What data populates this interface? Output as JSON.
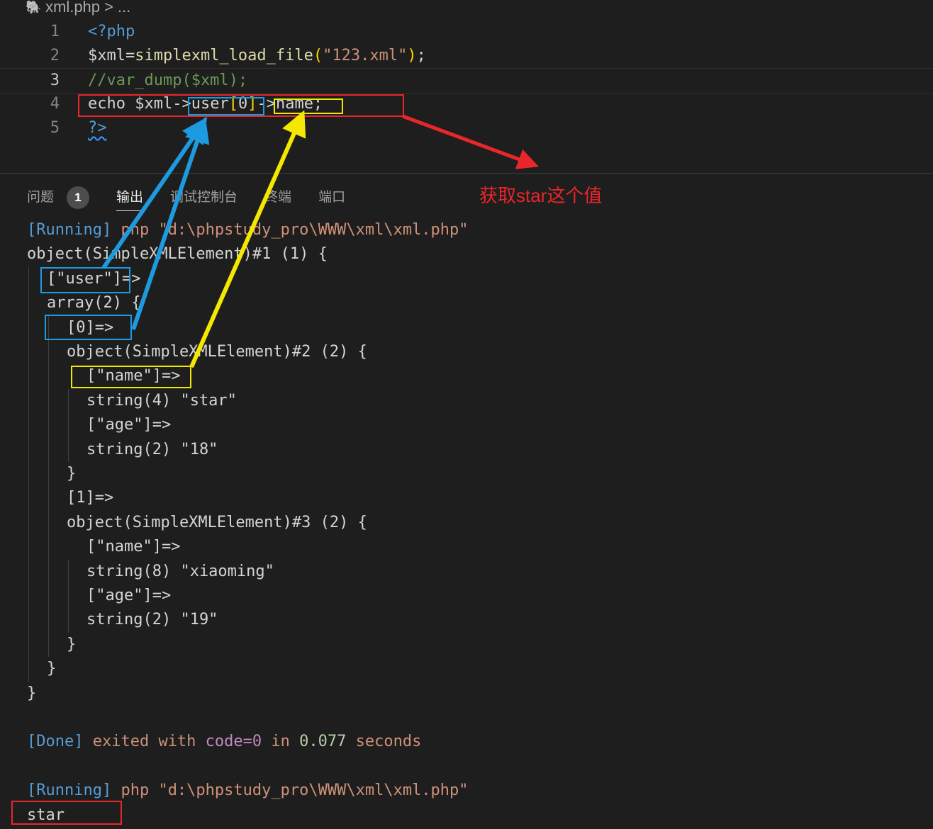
{
  "breadcrumb": {
    "file": "xml.php",
    "sep": ">",
    "more": "..."
  },
  "editor": {
    "lines": [
      {
        "n": "1",
        "parts": [
          {
            "t": "<?php",
            "c": "kw"
          }
        ]
      },
      {
        "n": "2",
        "parts": [
          {
            "t": "$xml",
            "c": "var"
          },
          {
            "t": "=",
            "c": "var"
          },
          {
            "t": "simplexml_load_file",
            "c": "fn"
          },
          {
            "t": "(",
            "c": "brk"
          },
          {
            "t": "\"123.xml\"",
            "c": "str"
          },
          {
            "t": ")",
            "c": "brk"
          },
          {
            "t": ";",
            "c": "var"
          }
        ]
      },
      {
        "n": "3",
        "parts": [
          {
            "t": "//var_dump($xml);",
            "c": "cmt"
          }
        ]
      },
      {
        "n": "4",
        "parts": [
          {
            "t": "echo ",
            "c": "var"
          },
          {
            "t": "$xml",
            "c": "var"
          },
          {
            "t": "-",
            "c": "var"
          },
          {
            "t": ">",
            "c": "var"
          },
          {
            "t": "user",
            "c": "var"
          },
          {
            "t": "[",
            "c": "brk"
          },
          {
            "t": "0",
            "c": "var"
          },
          {
            "t": "]",
            "c": "brk"
          },
          {
            "t": "-",
            "c": "var"
          },
          {
            "t": ">",
            "c": "var"
          },
          {
            "t": "name;",
            "c": "var"
          }
        ]
      },
      {
        "n": "5",
        "parts": [
          {
            "t": "?>",
            "c": "kw squig"
          }
        ]
      }
    ]
  },
  "panel": {
    "tabs": [
      {
        "label": "问题",
        "badge": "1"
      },
      {
        "label": "输出",
        "active": true
      },
      {
        "label": "调试控制台"
      },
      {
        "label": "终端"
      },
      {
        "label": "端口"
      }
    ]
  },
  "annotation": "获取star这个值",
  "output": [
    {
      "indent": 0,
      "parts": [
        {
          "t": "[Running]",
          "c": "blue-t"
        },
        {
          "t": " php \"d:\\phpstudy_pro\\WWW\\xml\\xml.php\"",
          "c": "org"
        }
      ]
    },
    {
      "indent": 0,
      "parts": [
        {
          "t": "object(SimpleXMLElement)#1 (1) {",
          "c": "var"
        }
      ]
    },
    {
      "indent": 1,
      "parts": [
        {
          "t": "[\"user\"]=>",
          "c": "var"
        }
      ]
    },
    {
      "indent": 1,
      "parts": [
        {
          "t": "array(2) {",
          "c": "var"
        }
      ]
    },
    {
      "indent": 2,
      "parts": [
        {
          "t": "[0]=>",
          "c": "var"
        }
      ]
    },
    {
      "indent": 2,
      "parts": [
        {
          "t": "object(SimpleXMLElement)#2 (2) {",
          "c": "var"
        }
      ]
    },
    {
      "indent": 3,
      "parts": [
        {
          "t": "[\"name\"]=>",
          "c": "var"
        }
      ]
    },
    {
      "indent": 3,
      "parts": [
        {
          "t": "string(4) \"star\"",
          "c": "var"
        }
      ]
    },
    {
      "indent": 3,
      "parts": [
        {
          "t": "[\"age\"]=>",
          "c": "var"
        }
      ]
    },
    {
      "indent": 3,
      "parts": [
        {
          "t": "string(2) \"18\"",
          "c": "var"
        }
      ]
    },
    {
      "indent": 2,
      "parts": [
        {
          "t": "}",
          "c": "var"
        }
      ]
    },
    {
      "indent": 2,
      "parts": [
        {
          "t": "[1]=>",
          "c": "var"
        }
      ]
    },
    {
      "indent": 2,
      "parts": [
        {
          "t": "object(SimpleXMLElement)#3 (2) {",
          "c": "var"
        }
      ]
    },
    {
      "indent": 3,
      "parts": [
        {
          "t": "[\"name\"]=>",
          "c": "var"
        }
      ]
    },
    {
      "indent": 3,
      "parts": [
        {
          "t": "string(8) \"xiaoming\"",
          "c": "var"
        }
      ]
    },
    {
      "indent": 3,
      "parts": [
        {
          "t": "[\"age\"]=>",
          "c": "var"
        }
      ]
    },
    {
      "indent": 3,
      "parts": [
        {
          "t": "string(2) \"19\"",
          "c": "var"
        }
      ]
    },
    {
      "indent": 2,
      "parts": [
        {
          "t": "}",
          "c": "var"
        }
      ]
    },
    {
      "indent": 1,
      "parts": [
        {
          "t": "}",
          "c": "var"
        }
      ]
    },
    {
      "indent": 0,
      "parts": [
        {
          "t": "}",
          "c": "var"
        }
      ]
    },
    {
      "indent": 0,
      "parts": []
    },
    {
      "indent": 0,
      "parts": [
        {
          "t": "[Done]",
          "c": "blue-t"
        },
        {
          "t": " exited with ",
          "c": "org"
        },
        {
          "t": "code=0",
          "c": "mag"
        },
        {
          "t": " in ",
          "c": "org"
        },
        {
          "t": "0.077",
          "c": "grn"
        },
        {
          "t": " seconds",
          "c": "org"
        }
      ]
    },
    {
      "indent": 0,
      "parts": []
    },
    {
      "indent": 0,
      "parts": [
        {
          "t": "[Running]",
          "c": "blue-t"
        },
        {
          "t": " php \"d:\\phpstudy_pro\\WWW\\xml\\xml.php\"",
          "c": "org"
        }
      ]
    },
    {
      "indent": 0,
      "parts": [
        {
          "t": "star",
          "c": "var"
        }
      ]
    }
  ],
  "colors": {
    "red": "#e8262b",
    "blue": "#1e9ae0",
    "yellow": "#f5e800"
  }
}
